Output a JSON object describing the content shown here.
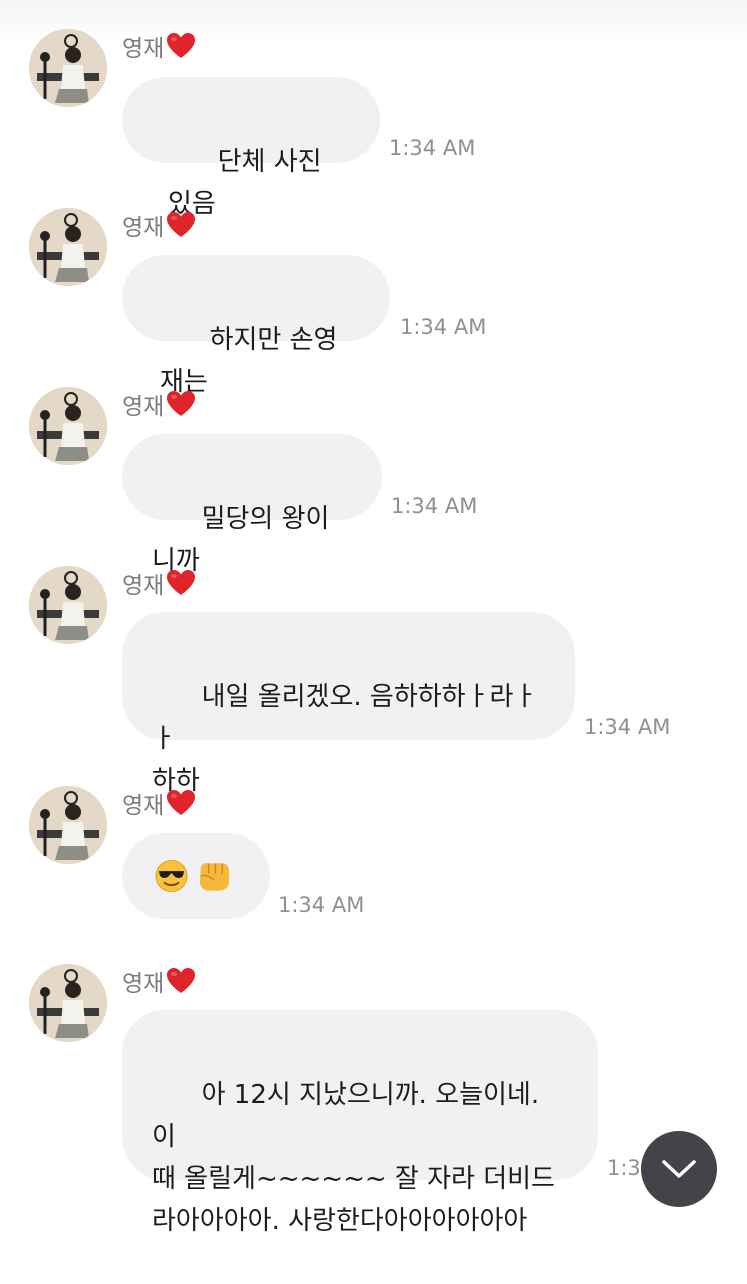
{
  "sender_name": "영재",
  "messages": [
    {
      "text": "단체 사진 있음",
      "time": "1:34 AM"
    },
    {
      "text": "하지만 손영재는",
      "time": "1:34 AM"
    },
    {
      "text": "밀당의 왕이니까",
      "time": "1:34 AM"
    },
    {
      "text": "내일 올리겠오. 음하하하ㅏ라ㅏㅏ\n하하",
      "time": "1:34 AM"
    },
    {
      "text": "",
      "emoji": [
        "smiling-face-with-sunglasses",
        "oncoming-fist"
      ],
      "time": "1:34 AM"
    },
    {
      "text": "아 12시 지났으니까. 오늘이네. 이\n때 올릴게~~~~~~ 잘 자라 더비드\n라아아아아. 사랑한다아아아아아아",
      "time": "1:3"
    }
  ],
  "icons": {
    "heart": "red-heart",
    "scroll": "chevron-down"
  },
  "colors": {
    "bubble": "#f1f1f4",
    "timestamp": "#8f8f94",
    "sender": "#7b7b80",
    "heart": "#e0242b",
    "scroll_button": "#444448"
  }
}
